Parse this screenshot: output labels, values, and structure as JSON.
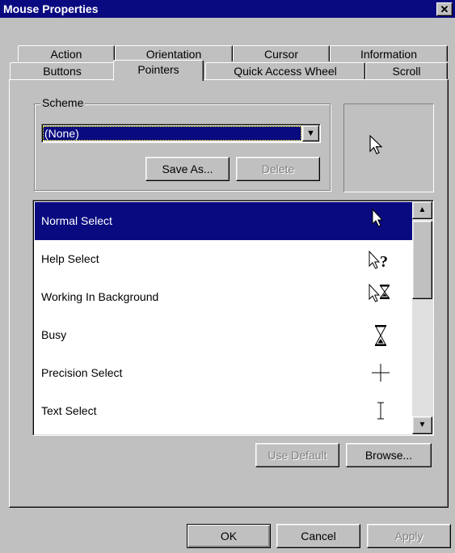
{
  "window": {
    "title": "Mouse Properties",
    "close_glyph": "✕"
  },
  "tabs_back_row": [
    "Action",
    "Orientation",
    "Cursor",
    "Information"
  ],
  "tabs_front_row": [
    "Buttons",
    "Pointers",
    "Quick Access Wheel",
    "Scroll"
  ],
  "active_tab": "Pointers",
  "scheme": {
    "label": "Scheme",
    "value": "(None)",
    "save_as": "Save As...",
    "delete": "Delete"
  },
  "cursors": [
    {
      "label": "Normal Select",
      "icon": "arrow-pointer-icon",
      "selected": true
    },
    {
      "label": "Help Select",
      "icon": "help-pointer-icon",
      "selected": false
    },
    {
      "label": "Working In Background",
      "icon": "working-pointer-icon",
      "selected": false
    },
    {
      "label": "Busy",
      "icon": "hourglass-icon",
      "selected": false
    },
    {
      "label": "Precision Select",
      "icon": "crosshair-icon",
      "selected": false
    },
    {
      "label": "Text Select",
      "icon": "ibeam-icon",
      "selected": false
    }
  ],
  "list_buttons": {
    "use_default": "Use Default",
    "browse": "Browse..."
  },
  "dialog_buttons": {
    "ok": "OK",
    "cancel": "Cancel",
    "apply": "Apply"
  },
  "colors": {
    "title_bg": "#0a0a80",
    "selection_bg": "#0a0a80",
    "face": "#c0c0c0"
  }
}
